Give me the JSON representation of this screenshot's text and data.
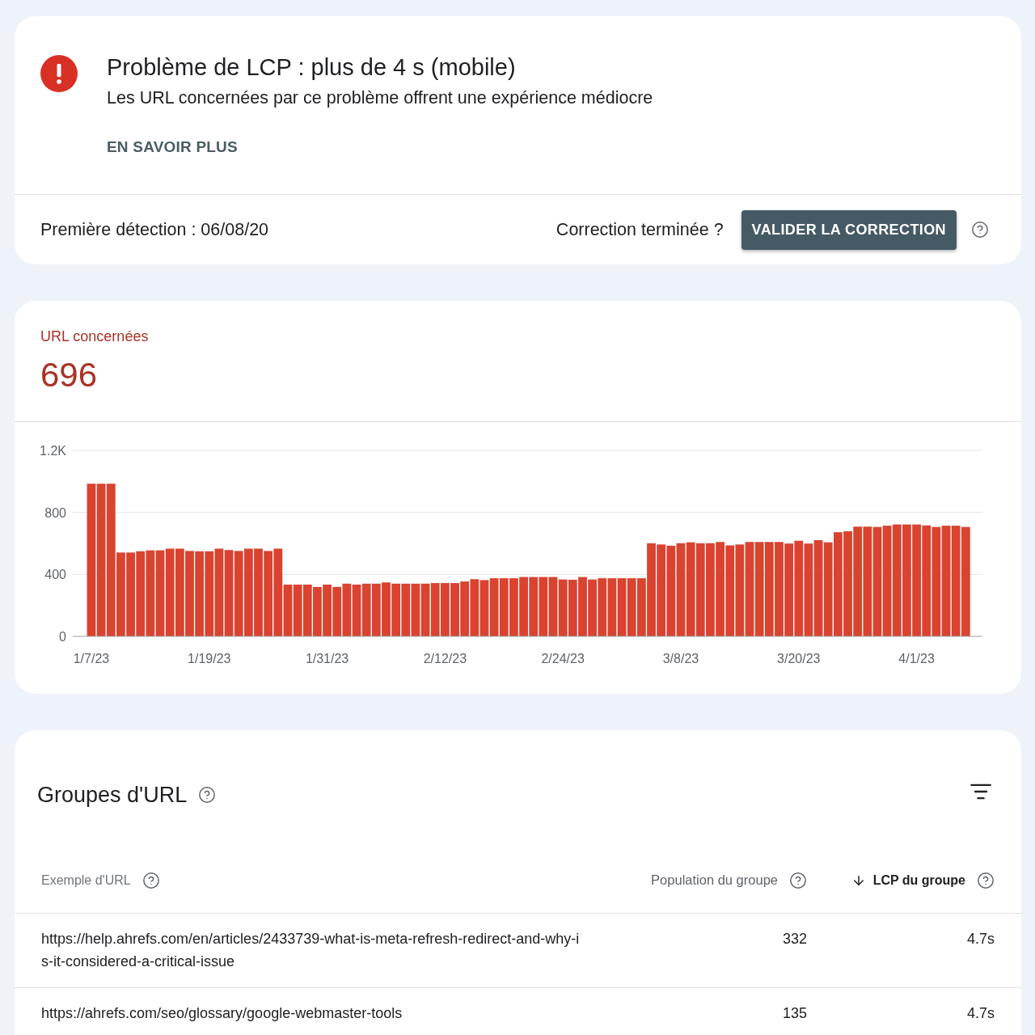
{
  "issue": {
    "title": "Problème de LCP : plus de 4 s (mobile)",
    "description": "Les URL concernées par ce problème offrent une expérience médiocre",
    "link": "EN SAVOIR PLUS"
  },
  "validation": {
    "first_detected": "Première détection : 06/08/20",
    "question": "Correction terminée ?",
    "button": "VALIDER LA CORRECTION"
  },
  "affected": {
    "label": "URL concernées",
    "count": "696",
    "chart_data": {
      "type": "bar",
      "categories": [
        "1/7/23",
        null,
        null,
        null,
        null,
        null,
        null,
        null,
        null,
        null,
        null,
        null,
        "1/19/23",
        null,
        null,
        null,
        null,
        null,
        null,
        null,
        null,
        null,
        null,
        null,
        "1/31/23",
        null,
        null,
        null,
        null,
        null,
        null,
        null,
        null,
        null,
        null,
        null,
        "2/12/23",
        null,
        null,
        null,
        null,
        null,
        null,
        null,
        null,
        null,
        null,
        null,
        "2/24/23",
        null,
        null,
        null,
        null,
        null,
        null,
        null,
        null,
        null,
        null,
        null,
        "3/8/23",
        null,
        null,
        null,
        null,
        null,
        null,
        null,
        null,
        null,
        null,
        null,
        "3/20/23",
        null,
        null,
        null,
        null,
        null,
        null,
        null,
        null,
        null,
        null,
        null,
        "4/1/23",
        null,
        null,
        null,
        null,
        null
      ],
      "values": [
        985,
        985,
        985,
        541,
        541,
        549,
        555,
        555,
        566,
        566,
        551,
        549,
        549,
        566,
        557,
        551,
        566,
        566,
        551,
        566,
        334,
        334,
        334,
        319,
        334,
        319,
        340,
        334,
        340,
        340,
        348,
        340,
        340,
        340,
        340,
        344,
        344,
        344,
        354,
        369,
        363,
        375,
        375,
        375,
        383,
        383,
        383,
        383,
        367,
        365,
        383,
        367,
        375,
        375,
        375,
        375,
        375,
        601,
        593,
        585,
        601,
        607,
        601,
        601,
        609,
        587,
        593,
        609,
        609,
        609,
        609,
        599,
        617,
        599,
        621,
        607,
        672,
        678,
        708,
        708,
        706,
        714,
        722,
        722,
        722,
        716,
        706,
        714,
        714,
        706
      ],
      "ylim": [
        0,
        1200
      ],
      "yticks": [
        0,
        400,
        800,
        {
          "value": 1200,
          "label": "1.2K"
        }
      ]
    }
  },
  "url_groups": {
    "title": "Groupes d'URL",
    "columns": [
      {
        "label": "Exemple d'URL",
        "sorted": false
      },
      {
        "label": "Population du groupe",
        "sorted": false
      },
      {
        "label": "LCP du groupe",
        "sorted": true
      }
    ],
    "rows": [
      {
        "url": "https://help.ahrefs.com/en/articles/2433739-what-is-meta-refresh-redirect-and-why-is-it-considered-a-critical-issue",
        "population": "332",
        "lcp": "4.7s"
      },
      {
        "url": "https://ahrefs.com/seo/glossary/google-webmaster-tools",
        "population": "135",
        "lcp": "4.7s"
      }
    ]
  }
}
